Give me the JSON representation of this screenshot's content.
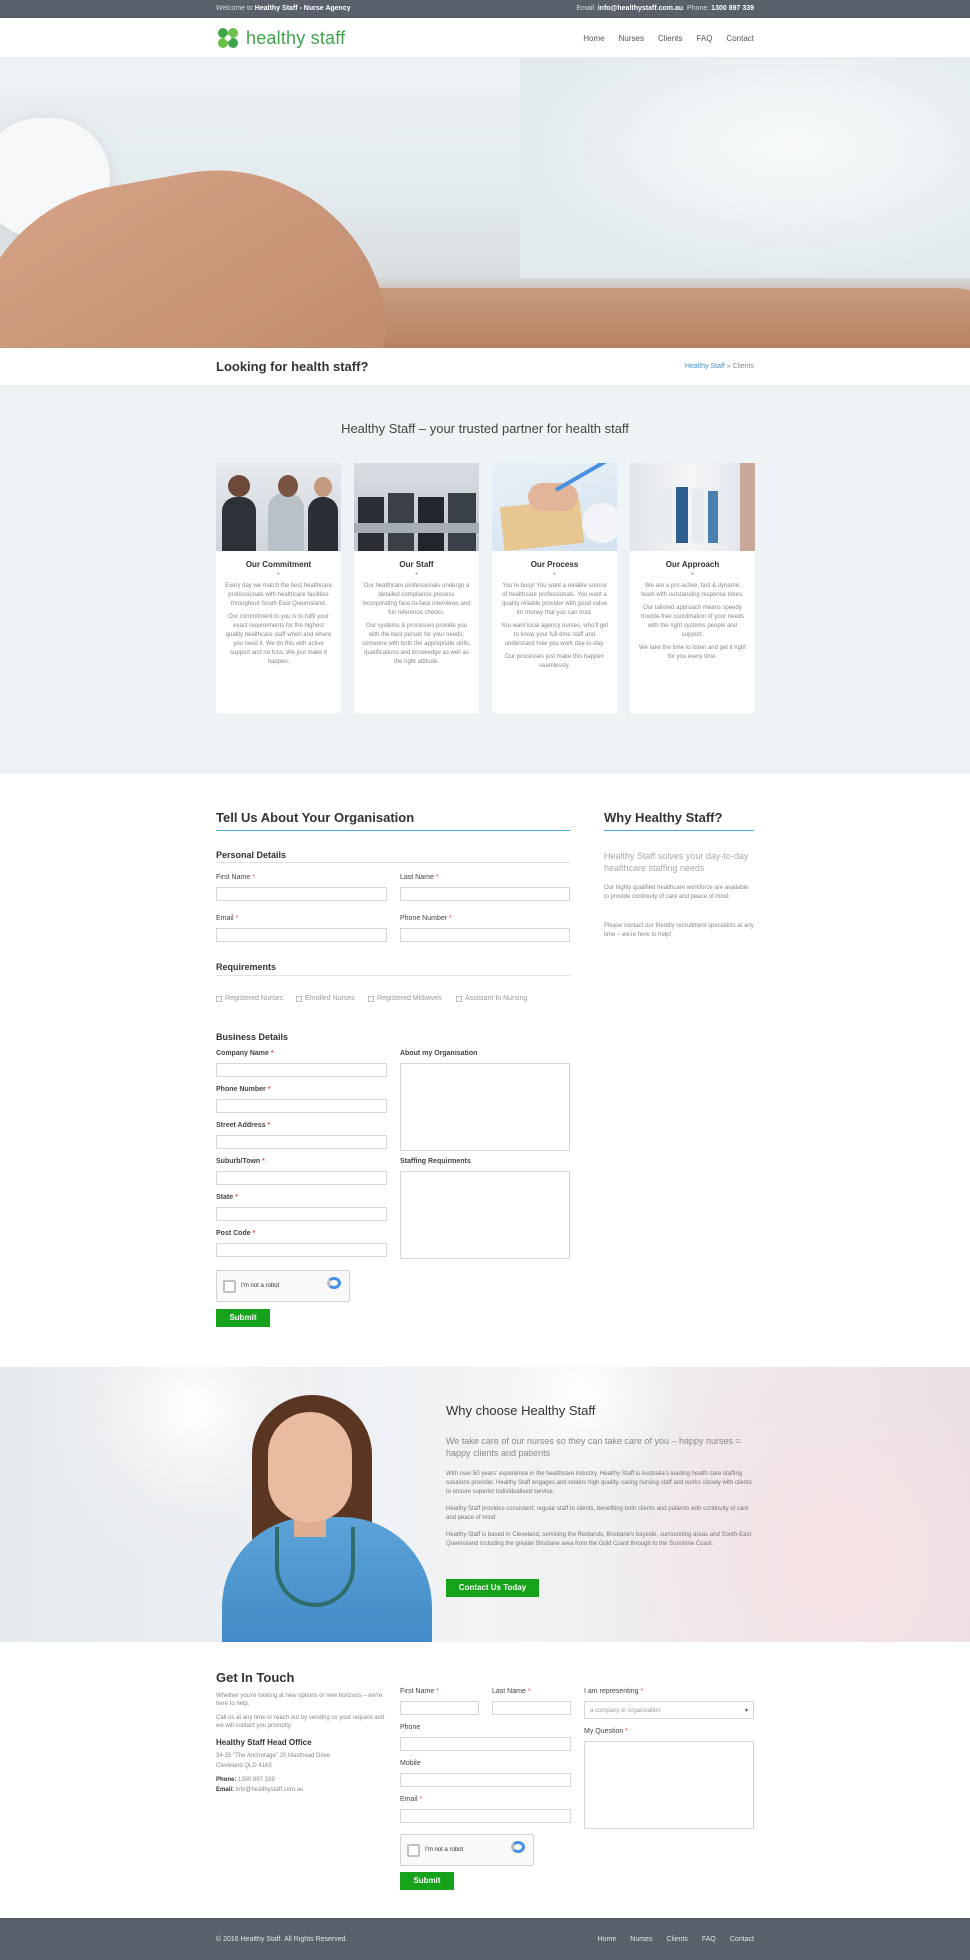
{
  "topbar": {
    "welcome_prefix": "Welcome to",
    "welcome_bold": "Healthy Staff - Nurse Agency",
    "email_label": "Email:",
    "email": "info@healthystaff.com.au",
    "phone_label": "Phone:",
    "phone": "1300 897 339"
  },
  "header": {
    "logo_text": "healthy staff",
    "nav": [
      "Home",
      "Nurses",
      "Clients",
      "FAQ",
      "Contact"
    ]
  },
  "titlebar": {
    "title": "Looking for health staff?",
    "crumb_link": "Healthy Staff",
    "crumb_sep": "»",
    "crumb_current": "Clients"
  },
  "partner": {
    "heading": "Healthy Staff – your trusted partner for health staff",
    "cards": [
      {
        "title": "Our Commitment",
        "dot": "•",
        "p1": "Every day we match the best healthcare professionals with healthcare facilities throughout South East Queensland.",
        "p2": "Our commitment to you is to fulfil your exact requirements for the highest quality healthcare staff when and where you need it. We do this with active support and no fuss. We just make it happen."
      },
      {
        "title": "Our Staff",
        "dot": "•",
        "p1": "Our healthcare professionals undergo a detailed compliance process incorporating face-to-face interviews and full reference checks.",
        "p2": "Our systems & processes provide you with the best person for your needs; someone with both the appropriate skills, qualifications and knowledge as well as the right attitude."
      },
      {
        "title": "Our Process",
        "dot": "•",
        "p1": "You're busy! You want a reliable source of healthcare professionals. You want a quality reliable provider with good value for money that you can trust.",
        "p2": "You want local agency nurses, who'll get to know your full-time staff and understand how you work day-to-day.",
        "p3": "Our processes just make this happen seamlessly."
      },
      {
        "title": "Our Approach",
        "dot": "•",
        "p1": "We are a pro-active, fast & dynamic team with outstanding response times.",
        "p2": "Our tailored approach means speedy trouble-free coordination of your needs with the right systems people and support.",
        "p3": "We take the time to listen and get it right for you every time."
      }
    ]
  },
  "org_form": {
    "title": "Tell Us About Your Organisation",
    "personal_heading": "Personal Details",
    "first_name": "First Name",
    "last_name": "Last Name",
    "email": "Email",
    "phone": "Phone Number",
    "req": "*",
    "requirements_heading": "Requirements",
    "checkboxes": [
      "Registered Nurses",
      "Enrolled Nurses",
      "Registered Midwives",
      "Assistant In Nursing"
    ],
    "business_heading": "Business Details",
    "company": "Company Name",
    "bphone": "Phone Number",
    "street": "Street Address",
    "suburb": "Suburb/Town",
    "state": "State",
    "postcode": "Post Code",
    "about": "About my Organisation",
    "staffing": "Staffing Requirments",
    "captcha_text": "I'm not a robot",
    "captcha_small": "reCAPTCHA\nPrivacy - Terms",
    "submit": "Submit"
  },
  "why": {
    "title": "Why Healthy Staff?",
    "lead": "Healthy Staff solves your day-to-day healthcare staffing needs",
    "p1": "Our highly qualified healthcare workforce are available to provide continuity of care and peace of mind.",
    "p2": "Please contact our friendly recruitment specialists at any time – we're here to help!"
  },
  "nurse": {
    "title": "Why choose Healthy Staff",
    "lead": "We take care of our nurses so they can take care of you – happy nurses = happy clients and patients",
    "p1": "With over 50 years' experience in the healthcare industry, Healthy Staff is Australia's leading health care staffing solutions provider. Healthy Staff engages and retains high quality, caring nursing staff and works closely with clients to ensure superior individualised service.",
    "p2": "Healthy Staff provides consistent, regular staff to clients, benefiting both clients and patients with continuity of care and peace of mind.",
    "p3": "Healthy Staff is based in Cleveland, servicing the Redlands, Brisbane's bayside, surrounding areas and South-East Queensland including the greater Brisbane area from the Gold Coast through to the Sunshine Coast.",
    "button": "Contact Us Today"
  },
  "contact": {
    "title": "Get In Touch",
    "p1": "Whether you're looking at new options or new horizons – we're here to help.",
    "p2": "Call us at any time or reach out by sending us your request and we will contact you promptly.",
    "office_title": "Healthy Staff Head Office",
    "addr1": "34-35 \"The Anchorage\" 20 Masthead Drive",
    "addr2": "Cleveland QLD 4163",
    "phone_label": "Phone:",
    "phone": "1300 897 339",
    "email_label": "Email:",
    "email": "info@healthystaff.com.au",
    "first_name": "First Name",
    "last_name": "Last Name",
    "representing": "I am representing",
    "select_value": "a company or organisation",
    "phone_field": "Phone",
    "mobile": "Mobile",
    "email_field": "Email",
    "question": "My Question",
    "req": "*",
    "captcha_text": "I'm not a robot",
    "submit": "Submit"
  },
  "footer": {
    "copyright": "© 2016 Healthy Staff. All Rights Reserved.",
    "nav": [
      "Home",
      "Nurses",
      "Clients",
      "FAQ",
      "Contact"
    ]
  },
  "colors": {
    "accent_green": "#16a21a",
    "topbar": "#595f6b",
    "link_blue": "#4aa8d8"
  }
}
